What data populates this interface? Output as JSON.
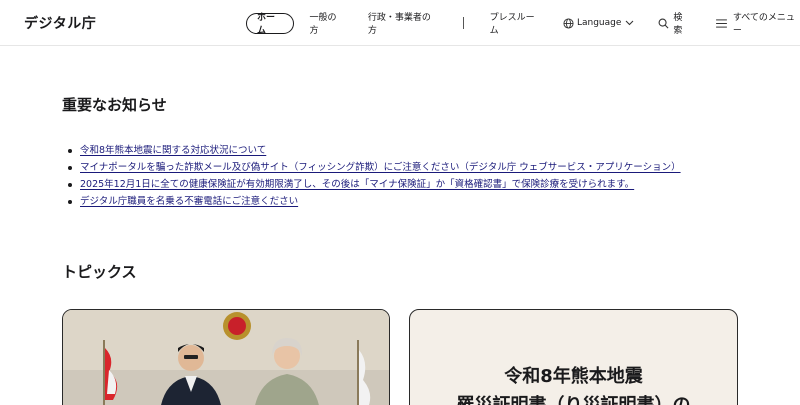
{
  "header": {
    "logo": "デジタル庁",
    "nav": {
      "home": "ホーム",
      "general": "一般の方",
      "business": "行政・事業者の方",
      "press": "プレスルーム",
      "language": "Language",
      "search": "検索",
      "menu": "すべてのメニュー"
    }
  },
  "notices": {
    "title": "重要なお知らせ",
    "items": [
      "令和8年熊本地震に関する対応状況について",
      "マイナポータルを騙った詐欺メール及び偽サイト（フィッシング詐欺）にご注意ください（デジタル庁 ウェブサービス・アプリケーション）",
      "2025年12月1日に全ての健康保険証が有効期限満了し、その後は「マイナ保険証」か「資格確認書」で保険診療を受けられます。",
      "デジタル庁職員を名乗る不審電話にご注意ください"
    ]
  },
  "topics": {
    "title": "トピックス",
    "card2": {
      "line1": "令和8年熊本地震",
      "line2": "罹災証明書（り災証明書）の"
    }
  },
  "colors": {
    "link": "#1a1a7a",
    "card_bg": "#f4efe8",
    "text": "#1a1a1c"
  }
}
